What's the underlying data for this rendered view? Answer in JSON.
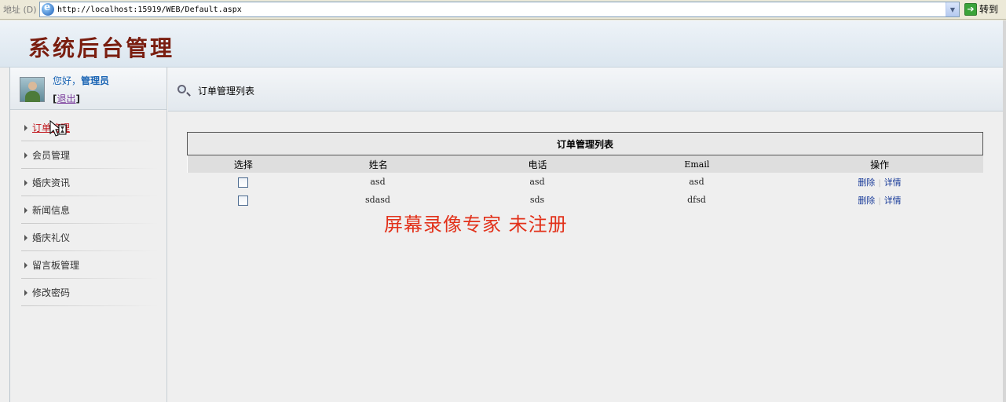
{
  "addressbar": {
    "label": "地址 (D)",
    "url": "http://localhost:15919/WEB/Default.aspx",
    "go_label": "转到"
  },
  "header": {
    "site_title": "系统后台管理"
  },
  "user": {
    "greeting": "您好，",
    "name": "管理员",
    "logout_open": "[",
    "logout_label": "退出",
    "logout_close": "]"
  },
  "sidebar": {
    "items": [
      {
        "label": "订单管理",
        "active": true
      },
      {
        "label": "会员管理"
      },
      {
        "label": "婚庆资讯"
      },
      {
        "label": "新闻信息"
      },
      {
        "label": "婚庆礼仪"
      },
      {
        "label": "留言板管理"
      },
      {
        "label": "修改密码"
      }
    ]
  },
  "content": {
    "title": "订单管理列表",
    "table_caption": "订单管理列表",
    "columns": [
      "选择",
      "姓名",
      "电话",
      "Email",
      "操作"
    ],
    "rows": [
      {
        "name": "asd",
        "phone": "asd",
        "email": "asd",
        "delete": "删除",
        "detail": "详情"
      },
      {
        "name": "sdasd",
        "phone": "sds",
        "email": "dfsd",
        "delete": "删除",
        "detail": "详情"
      }
    ],
    "separator": "|"
  },
  "watermark": "屏幕录像专家  未注册"
}
